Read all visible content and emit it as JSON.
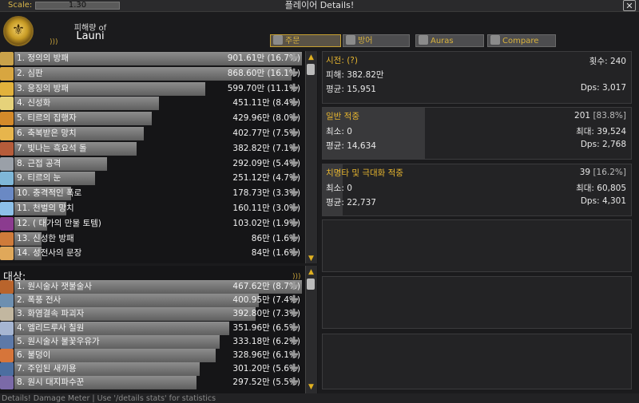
{
  "window": {
    "scale_label": "Scale:",
    "scale_value": "1.30",
    "title": "플레이어 Details!",
    "close_glyph": "✕"
  },
  "header": {
    "subtitle": "피해량 of",
    "player_name": "Launi",
    "icon": "paladin-class-icon"
  },
  "tabs": [
    {
      "label": "주문",
      "icon": "sword-icon",
      "active": true
    },
    {
      "label": "방어",
      "icon": "shield-icon",
      "active": false
    },
    {
      "label": "Auras",
      "icon": "aura-icon",
      "active": false
    },
    {
      "label": "Compare",
      "icon": "crown-icon",
      "active": false
    }
  ],
  "spells": [
    {
      "label": "1. 정의의 방패",
      "amount": "901.61만 (16.7%)",
      "pct": 16.7,
      "color": "#c9a24a"
    },
    {
      "label": "2. 심판",
      "amount": "868.60만 (16.1%)",
      "pct": 16.1,
      "color": "#d8a640"
    },
    {
      "label": "3. 응징의 방패",
      "amount": "599.70만 (11.1%)",
      "pct": 11.1,
      "color": "#e2b23c"
    },
    {
      "label": "4. 신성화",
      "amount": "451.11만 (8.4%)",
      "pct": 8.4,
      "color": "#e6d27a"
    },
    {
      "label": "5. 티르의 집행자",
      "amount": "429.96만 (8.0%)",
      "pct": 8.0,
      "color": "#d48a2a"
    },
    {
      "label": "6. 축복받은 망치",
      "amount": "402.77만 (7.5%)",
      "pct": 7.5,
      "color": "#e7b54c"
    },
    {
      "label": "7. 빛나는 흑요석 돌",
      "amount": "382.82만 (7.1%)",
      "pct": 7.1,
      "color": "#b65c3a"
    },
    {
      "label": "8. 근접 공격",
      "amount": "292.09만 (5.4%)",
      "pct": 5.4,
      "color": "#9aa0a8"
    },
    {
      "label": "9. 티르의 눈",
      "amount": "251.12만 (4.7%)",
      "pct": 4.7,
      "color": "#7fb7d8"
    },
    {
      "label": "10. 충격적인 폭로",
      "amount": "178.73만 (3.3%)",
      "pct": 3.3,
      "color": "#6a89c4"
    },
    {
      "label": "11. 천벌의 망치",
      "amount": "160.11만 (3.0%)",
      "pct": 3.0,
      "color": "#8dc0e8"
    },
    {
      "label": "12. (      대가의 만물 토템)",
      "amount": "103.02만 (1.9%)",
      "pct": 1.9,
      "color": "#8b3b8f"
    },
    {
      "label": "13. 신성한 방패",
      "amount": "86만 (1.6%)",
      "pct": 1.6,
      "color": "#cf7b3a"
    },
    {
      "label": "14. 성전사의 문장",
      "amount": "84만 (1.6%)",
      "pct": 1.6,
      "color": "#e0a85a"
    }
  ],
  "targets_title": "대상:",
  "targets": [
    {
      "label": "1. 원시술사 잿불술사",
      "amount": "467.62만 (8.7%)",
      "pct": 8.7,
      "color": "#b9642c"
    },
    {
      "label": "2. 폭풍 전사",
      "amount": "400.95만 (7.4%)",
      "pct": 7.4,
      "color": "#6d8fb0"
    },
    {
      "label": "3. 화염결속 파괴자",
      "amount": "392.80만 (7.3%)",
      "pct": 7.3,
      "color": "#c2b7a0"
    },
    {
      "label": "4. 엘리드루사 칠원",
      "amount": "351.96만 (6.5%)",
      "pct": 6.5,
      "color": "#a6b6d2"
    },
    {
      "label": "5. 원시술사 불꽃우유가",
      "amount": "333.18만 (6.2%)",
      "pct": 6.2,
      "color": "#5d79a8"
    },
    {
      "label": "6. 불덩이",
      "amount": "328.96만 (6.1%)",
      "pct": 6.1,
      "color": "#d6753a"
    },
    {
      "label": "7. 주입된 새끼용",
      "amount": "301.20만 (5.6%)",
      "pct": 5.6,
      "color": "#4c6ea0"
    },
    {
      "label": "8. 원시 대지파수꾼",
      "amount": "297.52만 (5.5%)",
      "pct": 5.5,
      "color": "#7b6aa8"
    }
  ],
  "detail": {
    "cast": {
      "title": "시전: (?)",
      "count": "횟수: 240",
      "damage": "피해: 382.82만",
      "avg": "평균: 15,951",
      "dps": "Dps: 3,017"
    },
    "normal": {
      "title": "일반 적중",
      "hits": "201",
      "hit_pct": "[83.8%]",
      "min": "최소: 0",
      "max": "최대: 39,524",
      "avg": "평균: 14,634",
      "dps": "Dps: 2,768",
      "fill": 83.8
    },
    "crit": {
      "title": "치명타 및 극대화 적중",
      "hits": "39",
      "hit_pct": "[16.2%]",
      "min": "최소: 0",
      "max": "최대: 60,805",
      "avg": "평균: 22,737",
      "dps": "Dps: 4,301",
      "fill": 16.2
    }
  },
  "status_text": "Details! Damage Meter | Use '/details stats' for statistics"
}
